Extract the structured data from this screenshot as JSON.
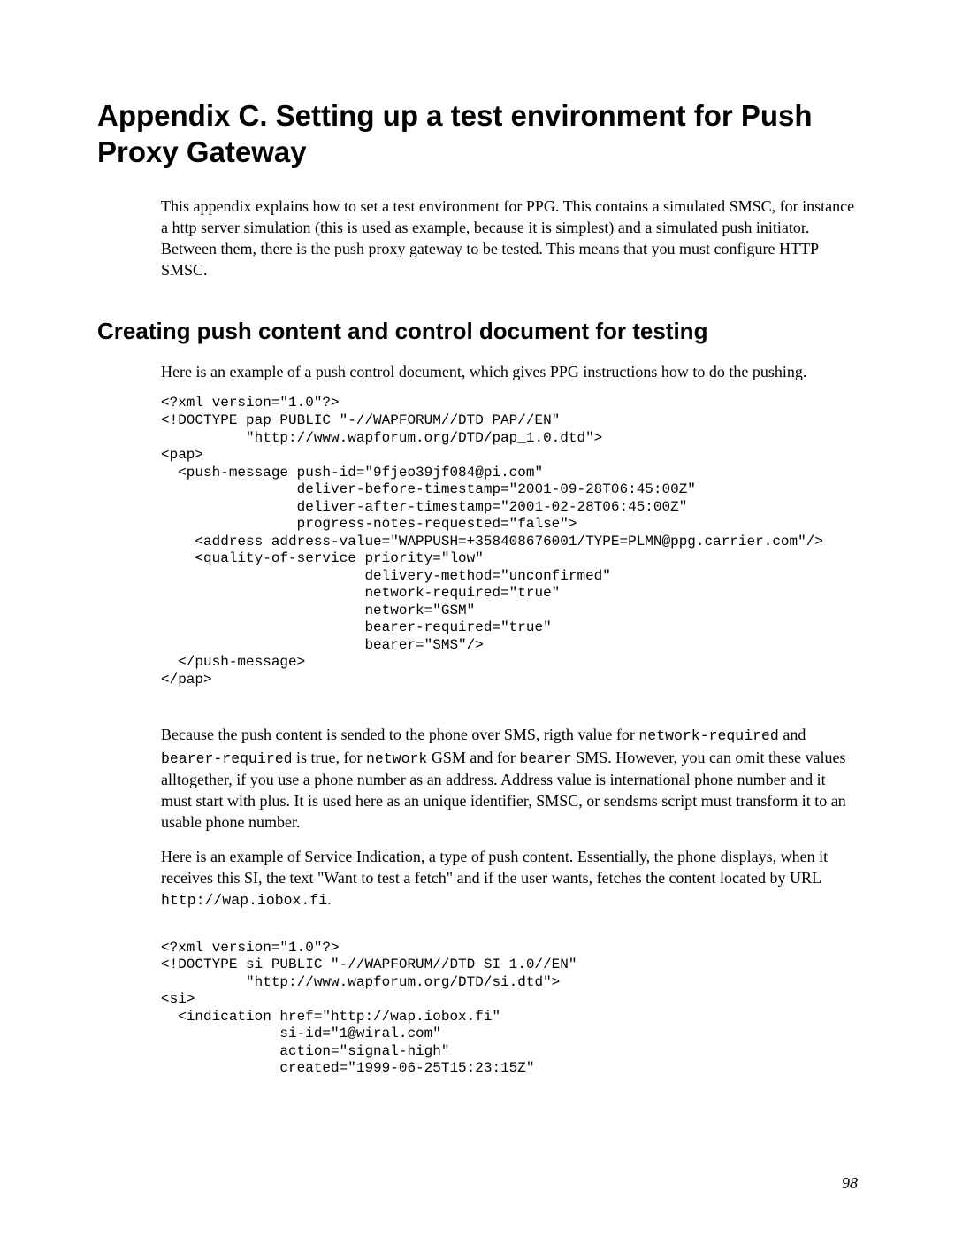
{
  "title": "Appendix C. Setting up a test environment for Push Proxy Gateway",
  "intro": "This appendix explains how to set a test environment for PPG. This contains a simulated SMSC, for instance a http server simulation (this is used as example, because it is simplest) and a simulated push initiator. Between them, there is the push proxy gateway to be tested. This means that you must configure HTTP SMSC.",
  "section_heading": "Creating push content and control document for testing",
  "para1": "Here is an example of a push control document, which gives PPG instructions how to do the pushing.",
  "code1": "<?xml version=\"1.0\"?>\n<!DOCTYPE pap PUBLIC \"-//WAPFORUM//DTD PAP//EN\"\n          \"http://www.wapforum.org/DTD/pap_1.0.dtd\">\n<pap>\n  <push-message push-id=\"9fjeo39jf084@pi.com\"\n                deliver-before-timestamp=\"2001-09-28T06:45:00Z\"\n                deliver-after-timestamp=\"2001-02-28T06:45:00Z\"\n                progress-notes-requested=\"false\">\n    <address address-value=\"WAPPUSH=+358408676001/TYPE=PLMN@ppg.carrier.com\"/>\n    <quality-of-service priority=\"low\"\n                        delivery-method=\"unconfirmed\"\n                        network-required=\"true\"\n                        network=\"GSM\"\n                        bearer-required=\"true\"\n                        bearer=\"SMS\"/>\n  </push-message>\n</pap>",
  "para2_a": "Because the push content is sended to the phone over SMS, rigth value for ",
  "para2_code1": "network-required",
  "para2_b": " and ",
  "para2_code2": "bearer-required",
  "para2_c": " is true, for ",
  "para2_code3": "network",
  "para2_d": " GSM and for ",
  "para2_code4": "bearer",
  "para2_e": " SMS. However, you can omit these values alltogether, if you use a phone number as an address. Address value is international phone number and it must start with plus. It is used here as an unique identifier, SMSC, or sendsms script must transform it to an usable phone number.",
  "para3_a": "Here is an example of Service Indication, a type of push content. Essentially, the phone displays, when it receives this SI, the text \"Want to test a fetch\" and if the user wants, fetches the content located by URL ",
  "para3_code1": "http://wap.iobox.fi",
  "para3_b": ".",
  "code2": "<?xml version=\"1.0\"?>\n<!DOCTYPE si PUBLIC \"-//WAPFORUM//DTD SI 1.0//EN\"\n          \"http://www.wapforum.org/DTD/si.dtd\">\n<si>\n  <indication href=\"http://wap.iobox.fi\"\n              si-id=\"1@wiral.com\"\n              action=\"signal-high\"\n              created=\"1999-06-25T15:23:15Z\"",
  "page_number": "98"
}
